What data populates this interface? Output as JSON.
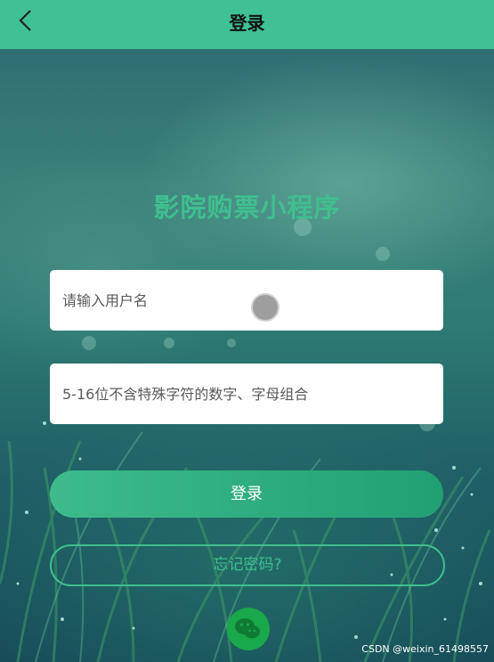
{
  "header": {
    "title": "登录",
    "back_icon": "chevron-left-icon"
  },
  "app": {
    "title": "影院购票小程序"
  },
  "form": {
    "username_placeholder": "请输入用户名",
    "password_placeholder": "5-16位不含特殊字符的数字、字母组合",
    "login_label": "登录",
    "forgot_label": "忘记密码?"
  },
  "social": {
    "wechat_icon": "wechat-icon"
  },
  "watermark": "CSDN @weixin_61498557",
  "colors": {
    "accent": "#3fc195",
    "title_green": "#3fbf8e",
    "button_start": "#3dbb8c",
    "button_end": "#21a074"
  }
}
